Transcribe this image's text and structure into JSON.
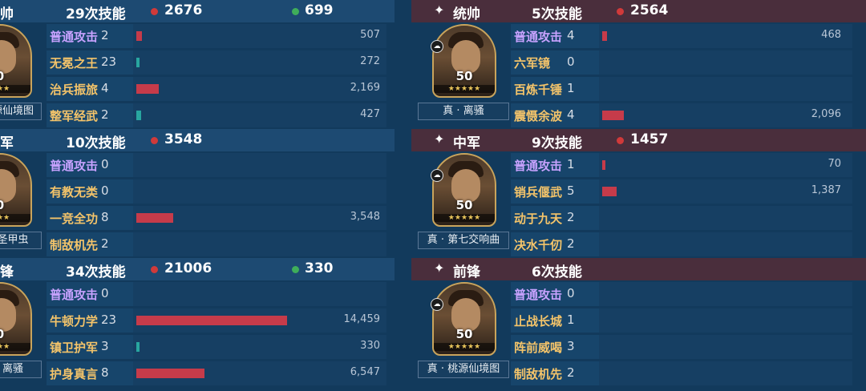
{
  "panels": [
    {
      "side": "left",
      "role": "帅",
      "count": "29次技能",
      "damage": "2676",
      "heal": "699",
      "level": "0",
      "stars": "★★★",
      "subname": "源仙境图",
      "skills": [
        {
          "name": "普通攻击",
          "color": "purple",
          "count": "2",
          "value": "507",
          "ratio": 0.035,
          "bar": "red"
        },
        {
          "name": "无冕之王",
          "color": "gold",
          "count": "23",
          "value": "272",
          "ratio": 0.019,
          "bar": "teal"
        },
        {
          "name": "治兵振旅",
          "color": "gold",
          "count": "4",
          "value": "2,169",
          "ratio": 0.15,
          "bar": "red"
        },
        {
          "name": "整军经武",
          "color": "gold",
          "count": "2",
          "value": "427",
          "ratio": 0.03,
          "bar": "teal"
        }
      ]
    },
    {
      "side": "left",
      "role": "军",
      "count": "10次技能",
      "damage": "3548",
      "heal": "",
      "level": "0",
      "stars": "★★★",
      "subname": "圣甲虫",
      "skills": [
        {
          "name": "普通攻击",
          "color": "purple",
          "count": "0",
          "value": "",
          "ratio": 0,
          "bar": "red"
        },
        {
          "name": "有教无类",
          "color": "gold",
          "count": "0",
          "value": "",
          "ratio": 0,
          "bar": "red"
        },
        {
          "name": "一竞全功",
          "color": "gold",
          "count": "8",
          "value": "3,548",
          "ratio": 0.245,
          "bar": "red"
        },
        {
          "name": "制敌机先",
          "color": "gold",
          "count": "2",
          "value": "",
          "ratio": 0,
          "bar": "red"
        }
      ]
    },
    {
      "side": "left",
      "role": "锋",
      "count": "34次技能",
      "damage": "21006",
      "heal": "330",
      "level": "0",
      "stars": "★★★",
      "subname": "离骚",
      "skills": [
        {
          "name": "普通攻击",
          "color": "purple",
          "count": "0",
          "value": "",
          "ratio": 0,
          "bar": "red"
        },
        {
          "name": "牛顿力学",
          "color": "gold",
          "count": "23",
          "value": "14,459",
          "ratio": 1.0,
          "bar": "red"
        },
        {
          "name": "镇卫护军",
          "color": "gold",
          "count": "3",
          "value": "330",
          "ratio": 0.023,
          "bar": "teal"
        },
        {
          "name": "护身真言",
          "color": "gold",
          "count": "8",
          "value": "6,547",
          "ratio": 0.45,
          "bar": "red"
        }
      ]
    },
    {
      "side": "right",
      "role": "统帅",
      "count": "5次技能",
      "damage": "2564",
      "heal": "",
      "level": "50",
      "stars": "★★★★★",
      "subname": "真 · 离骚",
      "skills": [
        {
          "name": "普通攻击",
          "color": "purple",
          "count": "4",
          "value": "468",
          "ratio": 0.032,
          "bar": "red"
        },
        {
          "name": "六军镜",
          "color": "gold",
          "count": "0",
          "value": "",
          "ratio": 0,
          "bar": "red"
        },
        {
          "name": "百炼千锤",
          "color": "gold",
          "count": "1",
          "value": "",
          "ratio": 0,
          "bar": "red"
        },
        {
          "name": "震慑余波",
          "color": "gold",
          "count": "4",
          "value": "2,096",
          "ratio": 0.145,
          "bar": "red"
        }
      ]
    },
    {
      "side": "right",
      "role": "中军",
      "count": "9次技能",
      "damage": "1457",
      "heal": "",
      "level": "50",
      "stars": "★★★★★",
      "subname": "真 · 第七交响曲",
      "skills": [
        {
          "name": "普通攻击",
          "color": "purple",
          "count": "1",
          "value": "70",
          "ratio": 0.006,
          "bar": "red"
        },
        {
          "name": "销兵偃武",
          "color": "gold",
          "count": "5",
          "value": "1,387",
          "ratio": 0.096,
          "bar": "red"
        },
        {
          "name": "动于九天",
          "color": "gold",
          "count": "2",
          "value": "",
          "ratio": 0,
          "bar": "red"
        },
        {
          "name": "决水千仞",
          "color": "gold",
          "count": "2",
          "value": "",
          "ratio": 0,
          "bar": "red"
        }
      ]
    },
    {
      "side": "right",
      "role": "前锋",
      "count": "6次技能",
      "damage": "",
      "heal": "",
      "level": "50",
      "stars": "★★★★★",
      "subname": "真 · 桃源仙境图",
      "skills": [
        {
          "name": "普通攻击",
          "color": "purple",
          "count": "0",
          "value": "",
          "ratio": 0,
          "bar": "red"
        },
        {
          "name": "止战长城",
          "color": "gold",
          "count": "1",
          "value": "",
          "ratio": 0,
          "bar": "red"
        },
        {
          "name": "阵前威喝",
          "color": "gold",
          "count": "3",
          "value": "",
          "ratio": 0,
          "bar": "red"
        },
        {
          "name": "制敌机先",
          "color": "gold",
          "count": "2",
          "value": "",
          "ratio": 0,
          "bar": "red"
        }
      ]
    }
  ]
}
